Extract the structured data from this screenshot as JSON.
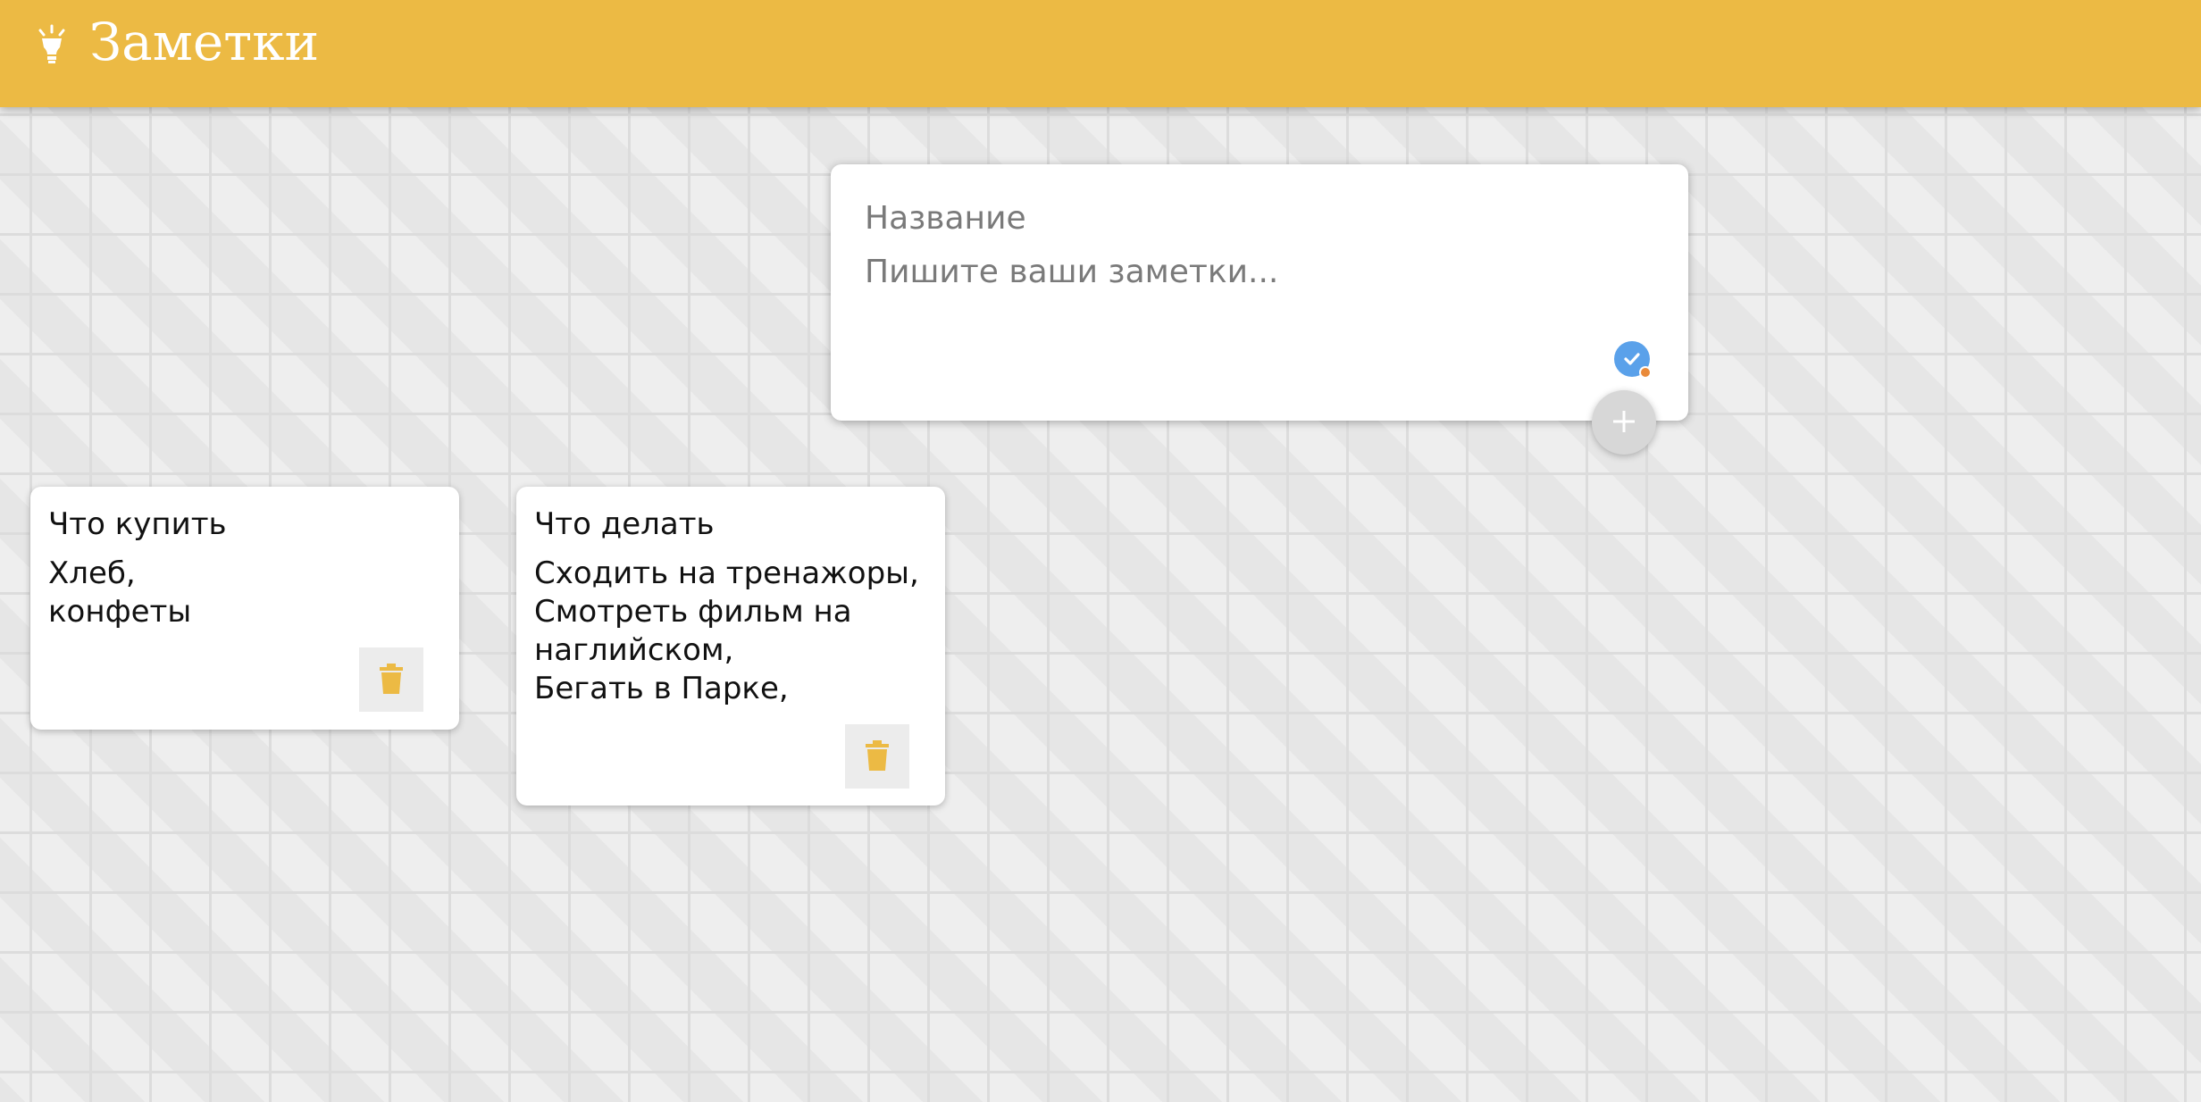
{
  "header": {
    "title": "Заметки",
    "icon": "lightbulb-icon",
    "color": "#ecba44"
  },
  "create_note": {
    "title_placeholder": "Название",
    "content_placeholder": "Пишите ваши заметки...",
    "check_icon": "check-circle-icon",
    "add_icon": "plus-icon"
  },
  "notes": [
    {
      "title": "Что купить",
      "lines": [
        "Хлеб,",
        "конфеты"
      ],
      "delete_icon": "trash-icon"
    },
    {
      "title": "Что делать",
      "lines": [
        "Сходить на тренажоры,",
        "Смотреть фильм на",
        "наглийском,",
        "Бегать в Парке,"
      ],
      "delete_icon": "trash-icon"
    }
  ],
  "colors": {
    "accent": "#ecba44",
    "check_blue": "#5aa1ea",
    "badge_orange": "#e98a3a"
  }
}
